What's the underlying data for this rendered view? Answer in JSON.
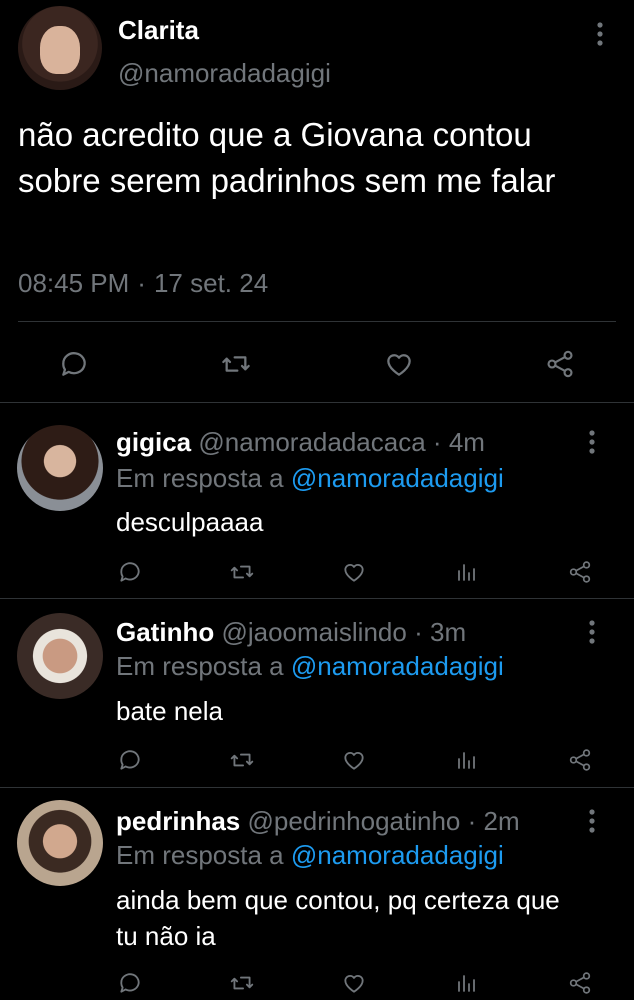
{
  "main": {
    "name": "Clarita",
    "handle": "@namoradadagigi",
    "text": "não acredito que a Giovana contou sobre serem padrinhos sem me falar",
    "time": "08:45 PM",
    "date": "17 set. 24"
  },
  "replies": [
    {
      "name": "gigica",
      "handle": "@namoradadacaca",
      "age": "4m",
      "reply_prefix": "Em resposta a ",
      "reply_to": "@namoradadagigi",
      "text": "desculpaaaa"
    },
    {
      "name": "Gatinho",
      "handle": "@jaoomaislindo",
      "age": "3m",
      "reply_prefix": "Em resposta a ",
      "reply_to": "@namoradadagigi",
      "text": "bate nela"
    },
    {
      "name": "pedrinhas",
      "handle": "@pedrinhogatinho",
      "age": "2m",
      "reply_prefix": "Em resposta a ",
      "reply_to": "@namoradadagigi",
      "text": "ainda bem que contou, pq certeza que tu não ia"
    }
  ],
  "colors": {
    "background": "#000000",
    "muted": "#71767b",
    "link": "#1d9bf0",
    "divider": "#2f3336"
  },
  "icons": [
    "reply-icon",
    "retweet-icon",
    "like-icon",
    "views-icon",
    "share-icon",
    "more-icon"
  ]
}
